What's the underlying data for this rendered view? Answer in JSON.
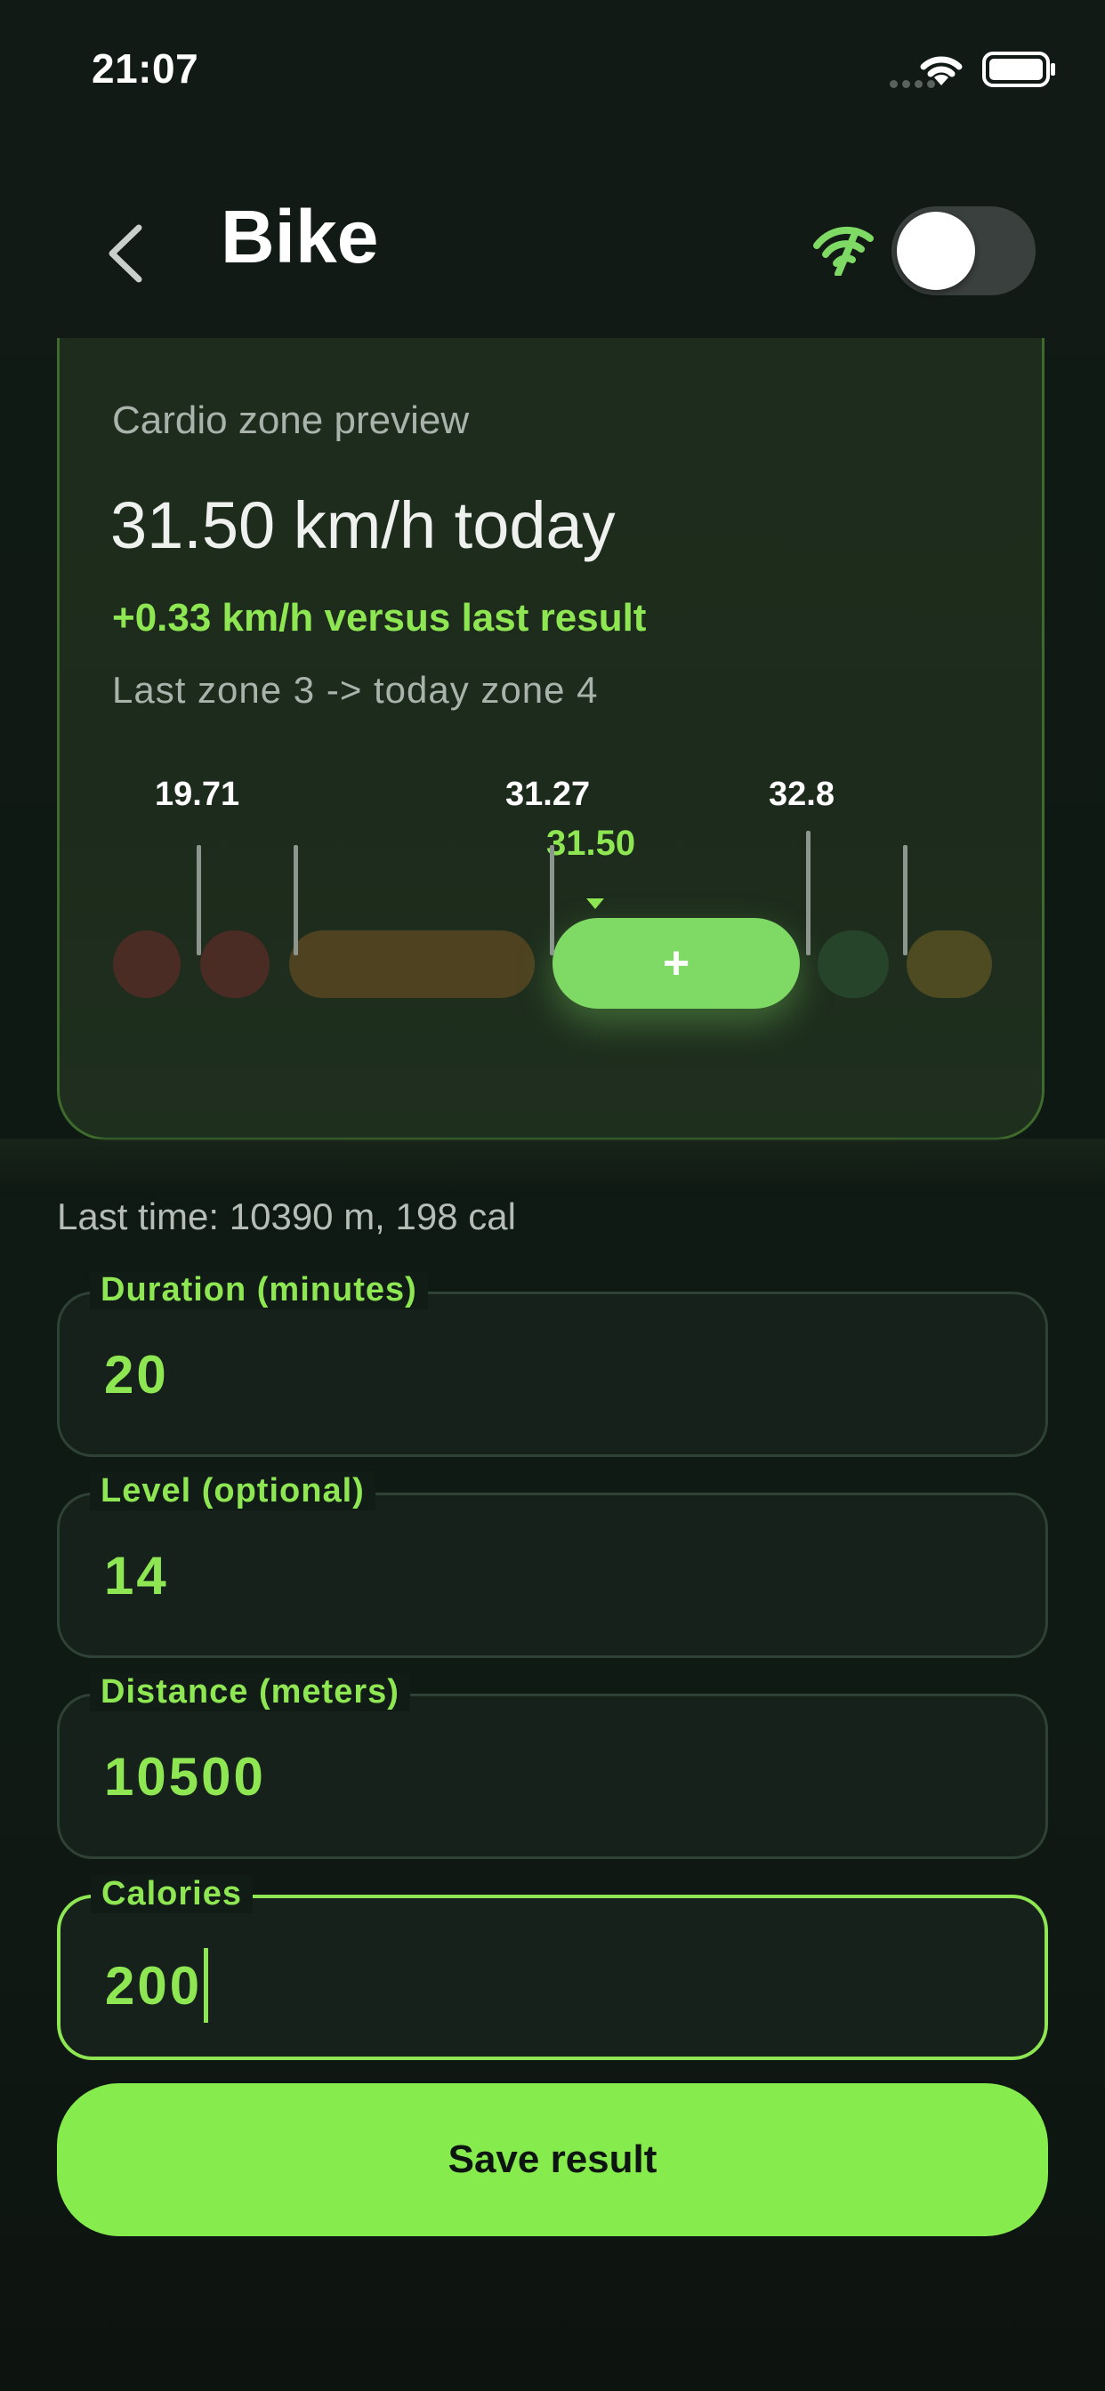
{
  "status_bar": {
    "time": "21:07"
  },
  "header": {
    "title": "Bike",
    "toggle_on": false
  },
  "card": {
    "subtitle": "Cardio zone preview",
    "speed_text": "31.50 km/h today",
    "delta_text": "+0.33 km/h versus last result",
    "zone_text": "Last zone 3  ->  today zone 4",
    "ticks": [
      "19.71",
      "31.27",
      "32.8"
    ],
    "current_value": "31.50",
    "active_zone_symbol": "+",
    "zone_colors": {
      "zone1": "#4a2c24",
      "zone2": "#4a2c24",
      "zone3": "#4e4220",
      "zone4": "#7fd965",
      "zone5": "#26442a",
      "zone6": "#4e4a22"
    }
  },
  "last_time": "Last time: 10390 m, 198 cal",
  "fields": {
    "duration": {
      "label": "Duration (minutes)",
      "value": "20"
    },
    "level": {
      "label": "Level (optional)",
      "value": "14"
    },
    "distance": {
      "label": "Distance (meters)",
      "value": "10500"
    },
    "calories": {
      "label": "Calories",
      "value": "200"
    }
  },
  "save_button": {
    "label": "Save result"
  },
  "colors": {
    "accent": "#86ec4e",
    "background": "#101a14",
    "text": "#ffffff"
  }
}
